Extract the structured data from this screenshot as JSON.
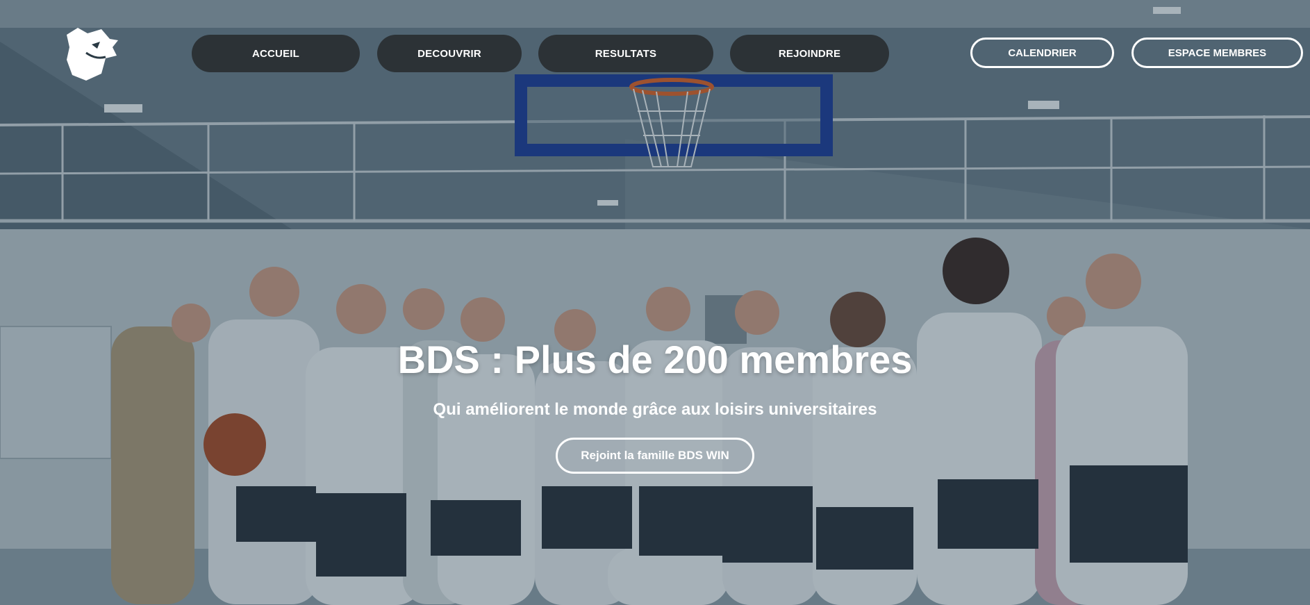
{
  "nav": {
    "logo_icon": "wolf-head-icon",
    "items": [
      {
        "label": "ACCUEIL"
      },
      {
        "label": "DECOUVRIR"
      },
      {
        "label": "RESULTATS"
      },
      {
        "label": "REJOINDRE"
      }
    ],
    "calendar_label": "CALENDRIER",
    "members_label": "ESPACE MEMBRES"
  },
  "hero": {
    "title": "BDS : Plus de 200 membres",
    "subtitle": "Qui améliorent le monde grâce aux loisirs universitaires",
    "cta_label": "Rejoint la famille BDS WIN"
  },
  "colors": {
    "overlay": "#142837",
    "nav_pill_bg": "#1e1e1e",
    "text": "#ffffff",
    "backboard": "#1f3f9a",
    "rim": "#d9652b"
  }
}
